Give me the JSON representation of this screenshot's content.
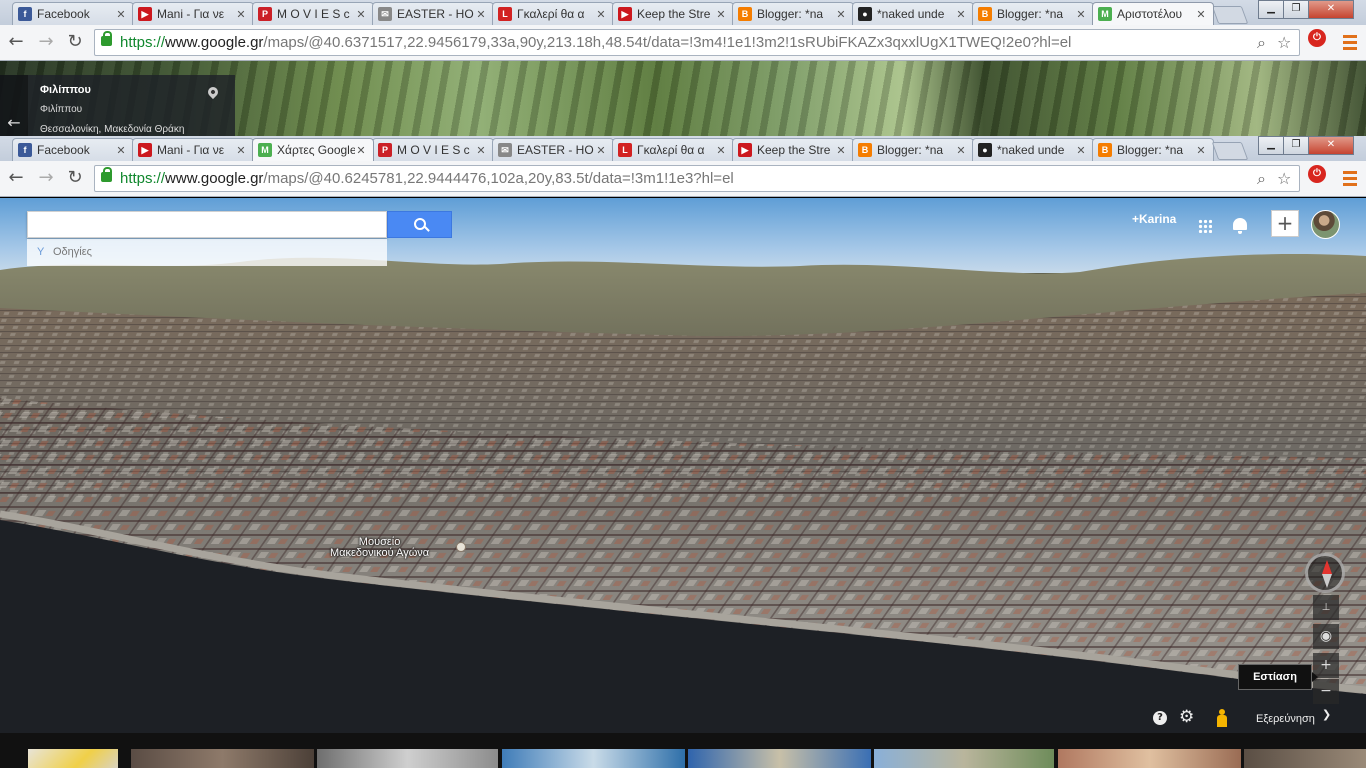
{
  "browser_back": {
    "tabs": [
      {
        "favicon": "facebook-icon",
        "favicon_color": "#3b5998",
        "favicon_glyph": "f",
        "title": "Facebook"
      },
      {
        "favicon": "youtube-icon",
        "favicon_color": "#cc181e",
        "favicon_glyph": "▶",
        "title": "Mani - Για νε"
      },
      {
        "favicon": "pinterest-icon",
        "favicon_color": "#cb2027",
        "favicon_glyph": "P",
        "title": "M O V I E S c"
      },
      {
        "favicon": "mail-icon",
        "favicon_color": "#888888",
        "favicon_glyph": "✉",
        "title": "EASTER - HO"
      },
      {
        "favicon": "lifo-icon",
        "favicon_color": "#d22222",
        "favicon_glyph": "L",
        "title": "Γκαλερί θα α"
      },
      {
        "favicon": "youtube-icon",
        "favicon_color": "#cc181e",
        "favicon_glyph": "▶",
        "title": "Keep the Stre"
      },
      {
        "favicon": "blogger-icon",
        "favicon_color": "#f57d00",
        "favicon_glyph": "B",
        "title": "Blogger: *na"
      },
      {
        "favicon": "paw-icon",
        "favicon_color": "#222222",
        "favicon_glyph": "●",
        "title": "*naked unde"
      },
      {
        "favicon": "blogger-icon",
        "favicon_color": "#f57d00",
        "favicon_glyph": "B",
        "title": "Blogger: *na"
      },
      {
        "favicon": "maps-icon",
        "favicon_color": "#4caf50",
        "favicon_glyph": "M",
        "title": "Αριστοτέλου"
      }
    ],
    "active_tab": 9,
    "url_scheme": "https://",
    "url_host": "www.google.gr",
    "url_path": "/maps/@40.6371517,22.9456179,33a,90y,213.18h,48.54t/data=!3m4!1e1!3m2!1sRUbiFKAZx3qxxlUgX1TWEQ!2e0?hl=el"
  },
  "streetview_card": {
    "title": "Φιλίππου",
    "subtitle": "Φιλίππου",
    "location": "Θεσσαλονίκη, Μακεδονία Θράκη"
  },
  "browser_front": {
    "tabs": [
      {
        "favicon": "facebook-icon",
        "favicon_color": "#3b5998",
        "favicon_glyph": "f",
        "title": "Facebook"
      },
      {
        "favicon": "youtube-icon",
        "favicon_color": "#cc181e",
        "favicon_glyph": "▶",
        "title": "Mani - Για νε"
      },
      {
        "favicon": "maps-icon",
        "favicon_color": "#4caf50",
        "favicon_glyph": "M",
        "title": "Χάρτες Google"
      },
      {
        "favicon": "pinterest-icon",
        "favicon_color": "#cb2027",
        "favicon_glyph": "P",
        "title": "M O V I E S c"
      },
      {
        "favicon": "mail-icon",
        "favicon_color": "#888888",
        "favicon_glyph": "✉",
        "title": "EASTER - HO"
      },
      {
        "favicon": "lifo-icon",
        "favicon_color": "#d22222",
        "favicon_glyph": "L",
        "title": "Γκαλερί θα α"
      },
      {
        "favicon": "youtube-icon",
        "favicon_color": "#cc181e",
        "favicon_glyph": "▶",
        "title": "Keep the Stre"
      },
      {
        "favicon": "blogger-icon",
        "favicon_color": "#f57d00",
        "favicon_glyph": "B",
        "title": "Blogger: *na"
      },
      {
        "favicon": "paw-icon",
        "favicon_color": "#222222",
        "favicon_glyph": "●",
        "title": "*naked unde"
      },
      {
        "favicon": "blogger-icon",
        "favicon_color": "#f57d00",
        "favicon_glyph": "B",
        "title": "Blogger: *na"
      }
    ],
    "active_tab": 2,
    "url_scheme": "https://",
    "url_host": "www.google.gr",
    "url_path": "/maps/@40.6245781,22.9444476,102a,20y,83.5t/data=!3m1!1e3?hl=el"
  },
  "maps": {
    "search_value": "",
    "directions_label": "Οδηγίες",
    "user_link": "+Karina",
    "place_label_line1": "Μουσείο",
    "place_label_line2": "Μακεδονικού Αγώνα",
    "focus_tooltip": "Εστίαση",
    "explore_label": "Εξερεύνηση",
    "help_glyph": "?",
    "zoom_in_glyph": "+",
    "zoom_out_glyph": "−"
  },
  "colors": {
    "search_button": "#4a89f3",
    "url_scheme": "#11882e",
    "compass_north": "#e3342f",
    "pegman": "#f5b400"
  }
}
